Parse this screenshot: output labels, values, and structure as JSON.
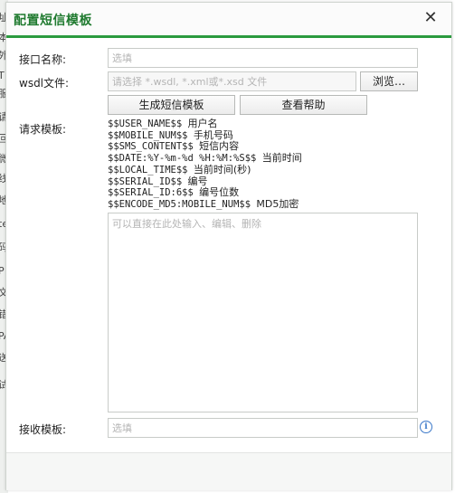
{
  "background_strip": [
    "址",
    "本",
    "外",
    "T",
    "服",
    "请",
    "回",
    "微",
    "线",
    "地",
    "te",
    "码",
    "P",
    "文",
    "错",
    "PA",
    "送",
    "试"
  ],
  "dialog": {
    "title": "配置短信模板"
  },
  "form": {
    "interface_name": {
      "label": "接口名称:",
      "placeholder": "选填",
      "value": ""
    },
    "wsdl_file": {
      "label": "wsdl文件:",
      "placeholder": "请选择 *.wsdl, *.xml或*.xsd 文件",
      "browse_label": "浏览…"
    },
    "generate_label": "生成短信模板",
    "help_label": "查看帮助",
    "request_template": {
      "label": "请求模板:",
      "variables": [
        {
          "code": "$$USER_NAME$$",
          "desc": "用户名"
        },
        {
          "code": "$$MOBILE_NUM$$",
          "desc": "手机号码"
        },
        {
          "code": "$$SMS_CONTENT$$",
          "desc": "短信内容"
        },
        {
          "code": "$$DATE:%Y-%m-%d %H:%M:%S$$",
          "desc": "当前时间"
        },
        {
          "code": "$$LOCAL_TIME$$",
          "desc": "当前时间(秒)"
        },
        {
          "code": "$$SERIAL_ID$$",
          "desc": "编号"
        },
        {
          "code": "$$SERIAL_ID:6$$",
          "desc": "编号位数"
        },
        {
          "code": "$$ENCODE_MD5:MOBILE_NUM$$",
          "desc": "MD5加密"
        }
      ],
      "placeholder": "可以直接在此处输入、编辑、删除"
    },
    "receive_template": {
      "label": "接收模板:",
      "placeholder": "选填"
    }
  },
  "colors": {
    "accent": "#2a9a3e",
    "title": "#1f7a2f",
    "info": "#3b78c9"
  }
}
